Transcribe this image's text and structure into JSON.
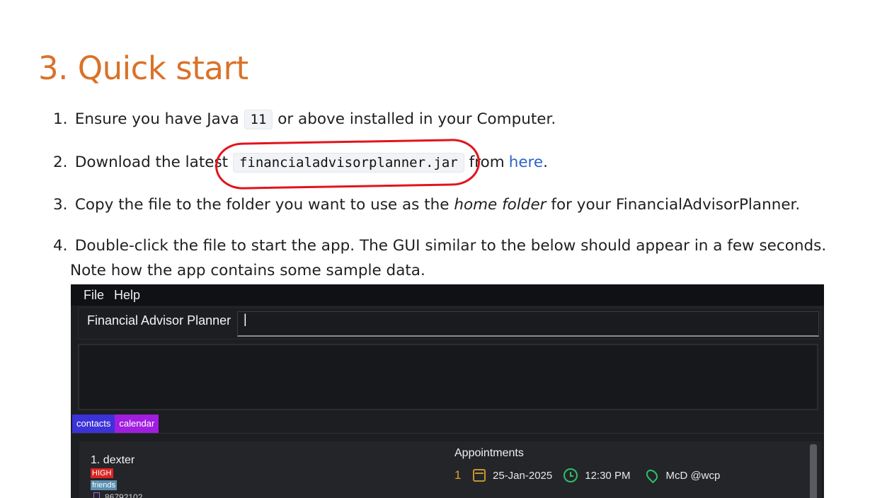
{
  "heading": "3. Quick start",
  "steps": [
    {
      "num": "1.",
      "pre": "Ensure you have Java",
      "code": "11",
      "post": "or above installed in your Computer."
    },
    {
      "num": "2.",
      "pre": "Download the latest",
      "code": "financialadvisorplanner.jar",
      "post": "from",
      "link": "here",
      "end": "."
    },
    {
      "num": "3.",
      "pre": "Copy the file to the folder you want to use as the",
      "em": "home folder",
      "post": "for your FinancialAdvisorPlanner."
    },
    {
      "num": "4.",
      "line1": "Double-click the file to start the app. The GUI similar to the below should appear in a few seconds.",
      "line2": "Note how the app contains some sample data."
    }
  ],
  "app": {
    "menu": [
      "File",
      "Help"
    ],
    "name": "Financial Advisor Planner",
    "command_value": "|",
    "tabs": [
      "contacts",
      "calendar"
    ],
    "person": {
      "name": "1.  dexter",
      "tags": [
        "HIGH",
        "friends"
      ],
      "phone": "86792102"
    },
    "appointments_title": "Appointments",
    "appointment": {
      "index": "1",
      "date": "25-Jan-2025",
      "time": "12:30 PM",
      "location": "McD @wcp"
    }
  },
  "colors": {
    "heading": "#d9722a",
    "link": "#2b64c8",
    "annotation": "#e0141e"
  }
}
